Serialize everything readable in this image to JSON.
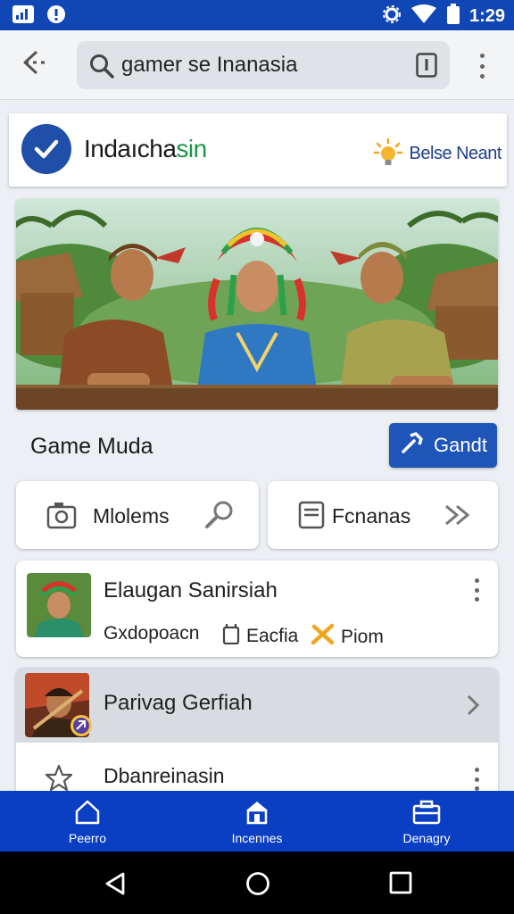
{
  "status_bar": {
    "time": "1:29"
  },
  "search": {
    "value": "gamer se Inanasia"
  },
  "brand": {
    "name_part1": "Indaıcha",
    "name_part2": "sin",
    "tagline": "Belse Neant"
  },
  "main": {
    "section_title": "Game Muda",
    "primary_button": "Gandt",
    "actions": [
      {
        "label": "Mlolems"
      },
      {
        "label": "Fcnanas"
      }
    ],
    "list_item": {
      "title": "Elaugan Sanirsiah",
      "meta": [
        {
          "label": "Gxdopoacn"
        },
        {
          "label": "Eacfia"
        },
        {
          "label": "Piom"
        }
      ]
    },
    "group": {
      "title": "Parivag Gerfiah",
      "item_label": "Dbanreinasin"
    }
  },
  "bottom_nav": {
    "items": [
      {
        "label": "Peerro"
      },
      {
        "label": "Incennes"
      },
      {
        "label": "Denagry"
      }
    ]
  },
  "colors": {
    "accent": "#1f55b8",
    "status_bar": "#1146b5",
    "bottom_nav": "#0a3fc4",
    "brand_green": "#1e9447"
  }
}
